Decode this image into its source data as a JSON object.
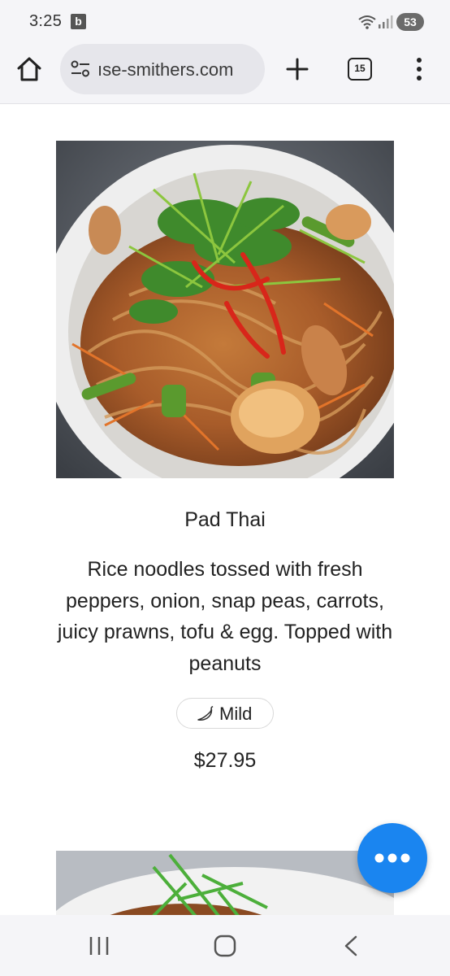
{
  "status_bar": {
    "time": "3:25",
    "notification_letter": "b",
    "battery": "53"
  },
  "browser": {
    "url": "ıse-smithers.com",
    "tab_count": "15"
  },
  "dish": {
    "name": "Pad Thai",
    "description": "Rice noodles tossed with fresh peppers, onion, snap peas, carrots, juicy prawns, tofu & egg. Topped with peanuts",
    "spice_level": "Mild",
    "price": "$27.95"
  },
  "icons": {
    "home": "home-icon",
    "site_settings": "tune-icon",
    "new_tab": "plus-icon",
    "tabs": "tab-switcher-icon",
    "menu": "more-vert-icon",
    "spice": "chili-pepper-icon",
    "chat": "chat-dots-icon"
  },
  "colors": {
    "chrome_background": "#f5f5f8",
    "url_pill": "#e6e6eb",
    "chat_button": "#1a85f0",
    "text": "#222222"
  }
}
